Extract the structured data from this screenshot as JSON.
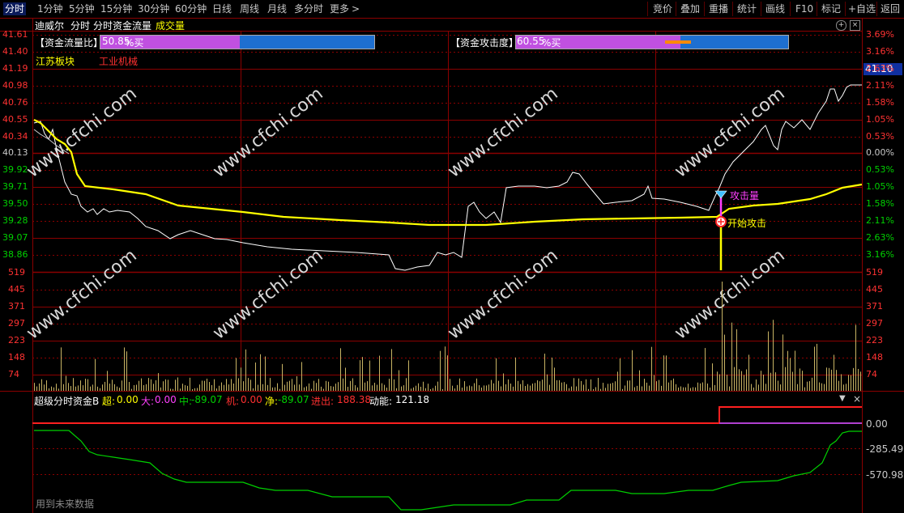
{
  "toolbar": {
    "tabs": [
      "分时",
      "1分钟",
      "5分钟",
      "15分钟",
      "30分钟",
      "60分钟",
      "日线",
      "周线",
      "月线",
      "多分时",
      "更多"
    ],
    "more_arrow": ">",
    "right_buttons": [
      "竞价",
      "叠加",
      "重播",
      "统计",
      "画线",
      "F10",
      "标记",
      "+自选",
      "返回"
    ]
  },
  "chart_header": {
    "stock_name": "迪威尔",
    "period": "分时",
    "indicator": "分时资金流量",
    "volume_label": "成交量",
    "sector": "江苏板块",
    "industry": "工业机械"
  },
  "gauges": {
    "flow_ratio": {
      "label": "【资金流量比】",
      "value": "50.85",
      "unit": "%买"
    },
    "attack": {
      "label": "【资金攻击度】",
      "value": "60.55",
      "unit": "%买"
    }
  },
  "price_axis": {
    "left": [
      "41.61",
      "41.40",
      "41.19",
      "40.98",
      "40.76",
      "40.55",
      "40.34",
      "40.13",
      "39.92",
      "39.71",
      "39.50",
      "39.28",
      "39.07",
      "38.86"
    ],
    "right": [
      "3.69%",
      "3.16%",
      "2.63%",
      "2.11%",
      "1.58%",
      "1.05%",
      "0.53%",
      "0.00%",
      "0.53%",
      "1.05%",
      "1.58%",
      "2.11%",
      "2.63%",
      "3.16%"
    ],
    "current_price": "41.10"
  },
  "volume_axis": {
    "left": [
      "519",
      "445",
      "371",
      "297",
      "223",
      "148",
      "74"
    ],
    "right": [
      "519",
      "445",
      "371",
      "297",
      "223",
      "148",
      "74"
    ]
  },
  "annotations": {
    "attack_volume": "攻击量",
    "start_attack": "开始攻击"
  },
  "indicator_panel": {
    "title": "超级分时资金B",
    "super_label": "超:",
    "super_value": "0.00",
    "big_label": "大:",
    "big_value": "0.00",
    "mid_label": "中:",
    "mid_value": "-89.07",
    "inst_label": "机:",
    "inst_value": "0.00",
    "net_label": "净:",
    "net_value": "-89.07",
    "inout_label": "进出:",
    "inout_value": "188.38",
    "momentum_label": "动能:",
    "momentum_value": "121.18",
    "axis": [
      "0.00",
      "-285.49",
      "-570.98"
    ],
    "footer_note": "用到未来数据"
  },
  "watermark": "www.cfchi.com",
  "colors": {
    "grid": "#8b0000",
    "price_line": "#ffffff",
    "avg_line": "#ffff00",
    "volume_bar": "#c8b464",
    "up_red": "#ff3232",
    "down_green": "#00d000",
    "magenta": "#ff40ff",
    "blue_bar": "#1e6fd0",
    "purple_bar": "#c050e0"
  }
}
